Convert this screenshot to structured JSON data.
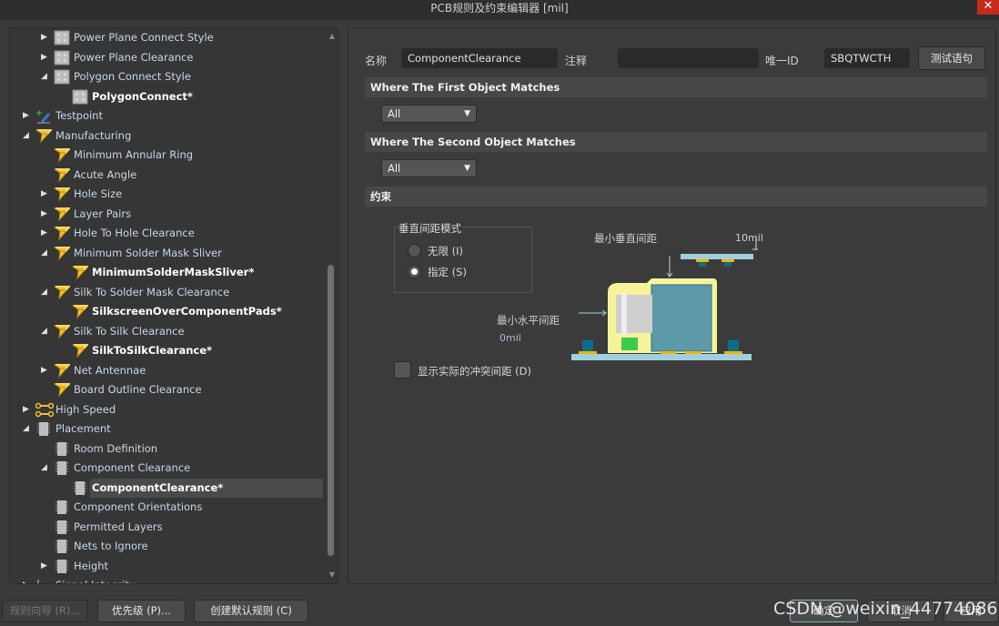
{
  "window": {
    "title": "PCB规则及约束编辑器 [mil]",
    "close": "✕"
  },
  "tree": [
    {
      "label": "Power Plane Connect Style",
      "level": 1,
      "toggle": "collapsed",
      "icon": "plane"
    },
    {
      "label": "Power Plane Clearance",
      "level": 1,
      "toggle": "collapsed",
      "icon": "plane"
    },
    {
      "label": "Polygon Connect Style",
      "level": 1,
      "toggle": "expanded",
      "icon": "plane"
    },
    {
      "label": "PolygonConnect*",
      "level": 2,
      "toggle": "none",
      "icon": "plane",
      "bold": true
    },
    {
      "label": "Testpoint",
      "level": 0,
      "toggle": "collapsed",
      "icon": "testpoint"
    },
    {
      "label": "Manufacturing",
      "level": 0,
      "toggle": "expanded",
      "icon": "mfg"
    },
    {
      "label": "Minimum Annular Ring",
      "level": 1,
      "toggle": "none",
      "icon": "mfg"
    },
    {
      "label": "Acute Angle",
      "level": 1,
      "toggle": "none",
      "icon": "mfg"
    },
    {
      "label": "Hole Size",
      "level": 1,
      "toggle": "collapsed",
      "icon": "mfg"
    },
    {
      "label": "Layer Pairs",
      "level": 1,
      "toggle": "collapsed",
      "icon": "mfg"
    },
    {
      "label": "Hole To Hole Clearance",
      "level": 1,
      "toggle": "collapsed",
      "icon": "mfg"
    },
    {
      "label": "Minimum Solder Mask Sliver",
      "level": 1,
      "toggle": "expanded",
      "icon": "mfg"
    },
    {
      "label": "MinimumSolderMaskSliver*",
      "level": 2,
      "toggle": "none",
      "icon": "mfg",
      "bold": true
    },
    {
      "label": "Silk To Solder Mask Clearance",
      "level": 1,
      "toggle": "expanded",
      "icon": "mfg"
    },
    {
      "label": "SilkscreenOverComponentPads*",
      "level": 2,
      "toggle": "none",
      "icon": "mfg",
      "bold": true
    },
    {
      "label": "Silk To Silk Clearance",
      "level": 1,
      "toggle": "expanded",
      "icon": "mfg"
    },
    {
      "label": "SilkToSilkClearance*",
      "level": 2,
      "toggle": "none",
      "icon": "mfg",
      "bold": true
    },
    {
      "label": "Net Antennae",
      "level": 1,
      "toggle": "collapsed",
      "icon": "mfg"
    },
    {
      "label": "Board Outline Clearance",
      "level": 1,
      "toggle": "none",
      "icon": "mfg"
    },
    {
      "label": "High Speed",
      "level": 0,
      "toggle": "collapsed",
      "icon": "highspeed"
    },
    {
      "label": "Placement",
      "level": 0,
      "toggle": "expanded",
      "icon": "chip"
    },
    {
      "label": "Room Definition",
      "level": 1,
      "toggle": "none",
      "icon": "chip"
    },
    {
      "label": "Component Clearance",
      "level": 1,
      "toggle": "expanded",
      "icon": "chip"
    },
    {
      "label": "ComponentClearance*",
      "level": 2,
      "toggle": "none",
      "icon": "chip",
      "bold": true,
      "selected": true
    },
    {
      "label": "Component Orientations",
      "level": 1,
      "toggle": "none",
      "icon": "chip"
    },
    {
      "label": "Permitted Layers",
      "level": 1,
      "toggle": "none",
      "icon": "chip"
    },
    {
      "label": "Nets to Ignore",
      "level": 1,
      "toggle": "none",
      "icon": "chip"
    },
    {
      "label": "Height",
      "level": 1,
      "toggle": "collapsed",
      "icon": "chip"
    },
    {
      "label": "Signal Integrity",
      "level": 0,
      "toggle": "collapsed",
      "icon": "signal"
    }
  ],
  "rule": {
    "name_label": "名称",
    "name_value": "ComponentClearance",
    "comment_label": "注释",
    "comment_value": "",
    "id_label": "唯一ID",
    "id_value": "SBQTWCTH",
    "test_button": "测试语句",
    "first_match": "Where The First Object Matches",
    "first_value": "All",
    "second_match": "Where The Second Object Matches",
    "second_value": "All",
    "constraints": "约束",
    "mode_group": "垂直间距模式",
    "radio_infinite": "无限 (I)",
    "radio_specified": "指定 (S)",
    "selected_mode": "specified",
    "min_vertical_label": "最小垂直间距",
    "min_vertical_value": "10mil",
    "min_horizontal_label": "最小水平间距",
    "min_horizontal_value": "0mil",
    "show_actual": "显示实际的冲突间距 (D)",
    "show_actual_checked": false
  },
  "footer": {
    "wizard": "规则向导 (R)...",
    "priority": "优先级 (P)...",
    "create_default": "创建默认规则 (C)",
    "ok": "确定",
    "cancel": "取消",
    "apply": "应用"
  },
  "watermark": "CSDN @weixin_44774086"
}
